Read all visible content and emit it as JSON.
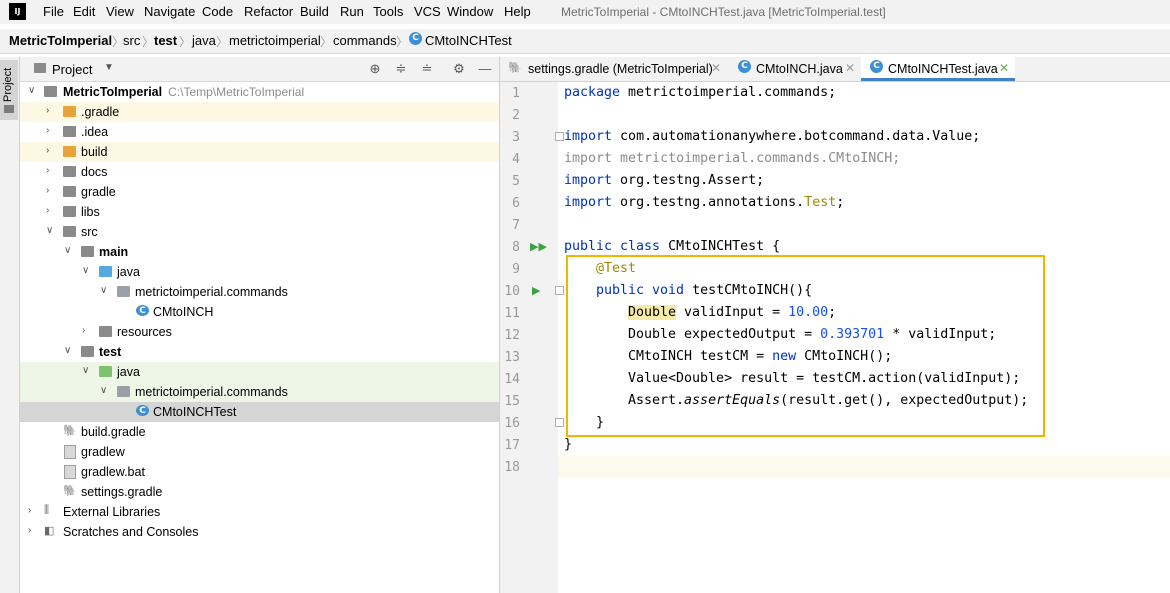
{
  "menubar": {
    "items": [
      "File",
      "Edit",
      "View",
      "Navigate",
      "Code",
      "Refactor",
      "Build",
      "Run",
      "Tools",
      "VCS",
      "Window",
      "Help"
    ],
    "window_title": "MetricToImperial - CMtoINCHTest.java [MetricToImperial.test]"
  },
  "breadcrumb": [
    "MetricToImperial",
    "src",
    "test",
    "java",
    "metrictoimperial",
    "commands",
    "CMtoINCHTest"
  ],
  "project_panel": {
    "title": "Project",
    "tree": [
      {
        "label": "MetricToImperial",
        "extra": "C:\\Temp\\MetricToImperial"
      },
      {
        "label": ".gradle"
      },
      {
        "label": ".idea"
      },
      {
        "label": "build"
      },
      {
        "label": "docs"
      },
      {
        "label": "gradle"
      },
      {
        "label": "libs"
      },
      {
        "label": "src"
      },
      {
        "label": "main"
      },
      {
        "label": "java"
      },
      {
        "label": "metrictoimperial.commands"
      },
      {
        "label": "CMtoINCH"
      },
      {
        "label": "resources"
      },
      {
        "label": "test"
      },
      {
        "label": "java"
      },
      {
        "label": "metrictoimperial.commands"
      },
      {
        "label": "CMtoINCHTest"
      },
      {
        "label": "build.gradle"
      },
      {
        "label": "gradlew"
      },
      {
        "label": "gradlew.bat"
      },
      {
        "label": "settings.gradle"
      },
      {
        "label": "External Libraries"
      },
      {
        "label": "Scratches and Consoles"
      }
    ]
  },
  "tabs": [
    {
      "label": "settings.gradle (MetricToImperial)"
    },
    {
      "label": "CMtoINCH.java"
    },
    {
      "label": "CMtoINCHTest.java"
    }
  ],
  "editor": {
    "line_numbers": [
      "1",
      "2",
      "3",
      "4",
      "5",
      "6",
      "7",
      "8",
      "9",
      "10",
      "11",
      "12",
      "13",
      "14",
      "15",
      "16",
      "17",
      "18"
    ],
    "lines": {
      "l1_kw": "package",
      "l1_rest": " metrictoimperial.commands;",
      "l3_kw": "import",
      "l3_rest": " com.automationanywhere.botcommand.data.Value;",
      "l4": "import metrictoimperial.commands.CMtoINCH;",
      "l5_kw": "import",
      "l5_rest": " org.testng.Assert;",
      "l6_kw": "import",
      "l6_rest": " org.testng.annotations.",
      "l6_ann": "Test",
      "l6_end": ";",
      "l8_kw": "public class",
      "l8_rest": " CMtoINCHTest {",
      "l9": "@Test",
      "l10_kw": "public void",
      "l10_rest": " testCMtoINCH(){",
      "l11_type": "Double",
      "l11_rest": " validInput = ",
      "l11_num": "10.00",
      "l11_end": ";",
      "l12_a": "Double expectedOutput = ",
      "l12_num": "0.393701",
      "l12_b": " * validInput;",
      "l13_a": "CMtoINCH testCM = ",
      "l13_kw": "new",
      "l13_b": " CMtoINCH();",
      "l14": "Value<Double> result = testCM.action(validInput);",
      "l15_a": "Assert.",
      "l15_it": "assertEquals",
      "l15_b": "(result.get(), expectedOutput);",
      "l16": "}",
      "l17": "}"
    }
  }
}
